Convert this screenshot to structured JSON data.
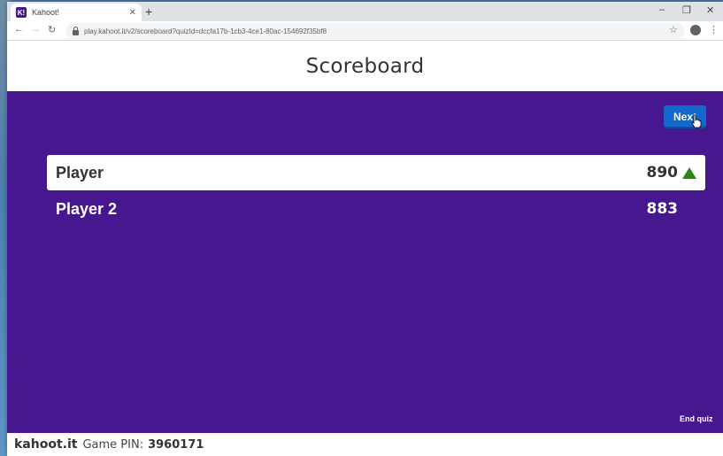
{
  "browser": {
    "tab_title": "Kahoot!",
    "tab_favicon": "K!",
    "new_tab": "+",
    "url": "play.kahoot.it/v2/scoreboard?quizId=dccfa17b-1cb3-4ce1-80ac-154692f35bf8",
    "minimize": "–",
    "restore": "❐",
    "close": "✕",
    "tab_close": "✕"
  },
  "page": {
    "title": "Scoreboard",
    "next_label": "Next",
    "end_quiz_label": "End quiz"
  },
  "scoreboard": [
    {
      "name": "Player",
      "score": "890",
      "trend": "up"
    },
    {
      "name": "Player 2",
      "score": "883",
      "trend": ""
    }
  ],
  "footer": {
    "brand": "kahoot.it",
    "pin_label": "Game PIN:",
    "pin_value": "3960171"
  },
  "colors": {
    "stage": "#46178f",
    "next_button": "#1368ce",
    "trend_up": "#26890c"
  }
}
